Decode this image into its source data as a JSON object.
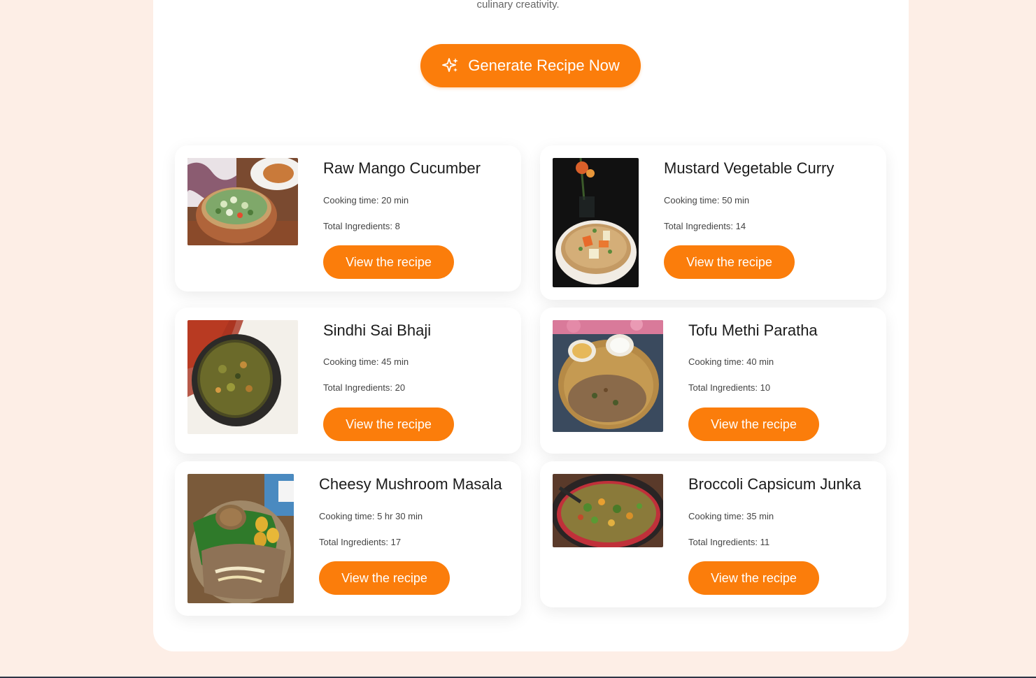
{
  "header": {
    "tagline": "culinary creativity.",
    "generate_button_label": "Generate Recipe Now",
    "generate_button_icon": "sparkles-icon"
  },
  "colors": {
    "page_background": "#fdeee6",
    "panel": "#ffffff",
    "accent": "#fb7d0b"
  },
  "recipes": [
    {
      "title": "Raw Mango Cucumber",
      "cooking_time": "Cooking time: 20 min",
      "total_ingredients": "Total Ingredients: 8",
      "button_label": "View the recipe"
    },
    {
      "title": "Mustard Vegetable Curry",
      "cooking_time": "Cooking time: 50 min",
      "total_ingredients": "Total Ingredients: 14",
      "button_label": "View the recipe"
    },
    {
      "title": "Sindhi Sai Bhaji",
      "cooking_time": "Cooking time: 45 min",
      "total_ingredients": "Total Ingredients: 20",
      "button_label": "View the recipe"
    },
    {
      "title": "Tofu Methi Paratha",
      "cooking_time": "Cooking time: 40 min",
      "total_ingredients": "Total Ingredients: 10",
      "button_label": "View the recipe"
    },
    {
      "title": "Cheesy Mushroom Masala",
      "cooking_time": "Cooking time: 5 hr 30 min",
      "total_ingredients": "Total Ingredients: 17",
      "button_label": "View the recipe"
    },
    {
      "title": "Broccoli Capsicum Junka",
      "cooking_time": "Cooking time: 35 min",
      "total_ingredients": "Total Ingredients: 11",
      "button_label": "View the recipe"
    }
  ]
}
